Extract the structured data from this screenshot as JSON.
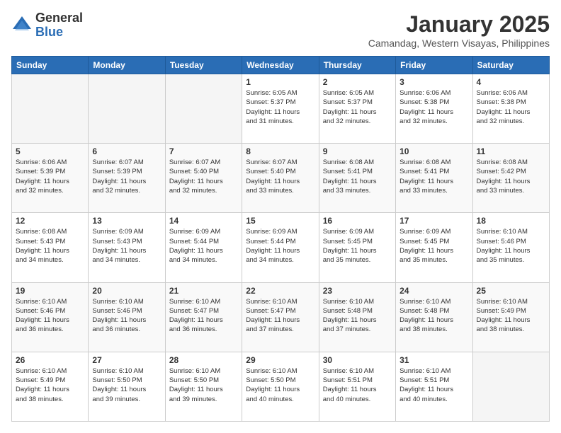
{
  "header": {
    "logo_general": "General",
    "logo_blue": "Blue",
    "month_title": "January 2025",
    "location": "Camandag, Western Visayas, Philippines"
  },
  "weekdays": [
    "Sunday",
    "Monday",
    "Tuesday",
    "Wednesday",
    "Thursday",
    "Friday",
    "Saturday"
  ],
  "weeks": [
    [
      {
        "day": "",
        "info": ""
      },
      {
        "day": "",
        "info": ""
      },
      {
        "day": "",
        "info": ""
      },
      {
        "day": "1",
        "info": "Sunrise: 6:05 AM\nSunset: 5:37 PM\nDaylight: 11 hours\nand 31 minutes."
      },
      {
        "day": "2",
        "info": "Sunrise: 6:05 AM\nSunset: 5:37 PM\nDaylight: 11 hours\nand 32 minutes."
      },
      {
        "day": "3",
        "info": "Sunrise: 6:06 AM\nSunset: 5:38 PM\nDaylight: 11 hours\nand 32 minutes."
      },
      {
        "day": "4",
        "info": "Sunrise: 6:06 AM\nSunset: 5:38 PM\nDaylight: 11 hours\nand 32 minutes."
      }
    ],
    [
      {
        "day": "5",
        "info": "Sunrise: 6:06 AM\nSunset: 5:39 PM\nDaylight: 11 hours\nand 32 minutes."
      },
      {
        "day": "6",
        "info": "Sunrise: 6:07 AM\nSunset: 5:39 PM\nDaylight: 11 hours\nand 32 minutes."
      },
      {
        "day": "7",
        "info": "Sunrise: 6:07 AM\nSunset: 5:40 PM\nDaylight: 11 hours\nand 32 minutes."
      },
      {
        "day": "8",
        "info": "Sunrise: 6:07 AM\nSunset: 5:40 PM\nDaylight: 11 hours\nand 33 minutes."
      },
      {
        "day": "9",
        "info": "Sunrise: 6:08 AM\nSunset: 5:41 PM\nDaylight: 11 hours\nand 33 minutes."
      },
      {
        "day": "10",
        "info": "Sunrise: 6:08 AM\nSunset: 5:41 PM\nDaylight: 11 hours\nand 33 minutes."
      },
      {
        "day": "11",
        "info": "Sunrise: 6:08 AM\nSunset: 5:42 PM\nDaylight: 11 hours\nand 33 minutes."
      }
    ],
    [
      {
        "day": "12",
        "info": "Sunrise: 6:08 AM\nSunset: 5:43 PM\nDaylight: 11 hours\nand 34 minutes."
      },
      {
        "day": "13",
        "info": "Sunrise: 6:09 AM\nSunset: 5:43 PM\nDaylight: 11 hours\nand 34 minutes."
      },
      {
        "day": "14",
        "info": "Sunrise: 6:09 AM\nSunset: 5:44 PM\nDaylight: 11 hours\nand 34 minutes."
      },
      {
        "day": "15",
        "info": "Sunrise: 6:09 AM\nSunset: 5:44 PM\nDaylight: 11 hours\nand 34 minutes."
      },
      {
        "day": "16",
        "info": "Sunrise: 6:09 AM\nSunset: 5:45 PM\nDaylight: 11 hours\nand 35 minutes."
      },
      {
        "day": "17",
        "info": "Sunrise: 6:09 AM\nSunset: 5:45 PM\nDaylight: 11 hours\nand 35 minutes."
      },
      {
        "day": "18",
        "info": "Sunrise: 6:10 AM\nSunset: 5:46 PM\nDaylight: 11 hours\nand 35 minutes."
      }
    ],
    [
      {
        "day": "19",
        "info": "Sunrise: 6:10 AM\nSunset: 5:46 PM\nDaylight: 11 hours\nand 36 minutes."
      },
      {
        "day": "20",
        "info": "Sunrise: 6:10 AM\nSunset: 5:46 PM\nDaylight: 11 hours\nand 36 minutes."
      },
      {
        "day": "21",
        "info": "Sunrise: 6:10 AM\nSunset: 5:47 PM\nDaylight: 11 hours\nand 36 minutes."
      },
      {
        "day": "22",
        "info": "Sunrise: 6:10 AM\nSunset: 5:47 PM\nDaylight: 11 hours\nand 37 minutes."
      },
      {
        "day": "23",
        "info": "Sunrise: 6:10 AM\nSunset: 5:48 PM\nDaylight: 11 hours\nand 37 minutes."
      },
      {
        "day": "24",
        "info": "Sunrise: 6:10 AM\nSunset: 5:48 PM\nDaylight: 11 hours\nand 38 minutes."
      },
      {
        "day": "25",
        "info": "Sunrise: 6:10 AM\nSunset: 5:49 PM\nDaylight: 11 hours\nand 38 minutes."
      }
    ],
    [
      {
        "day": "26",
        "info": "Sunrise: 6:10 AM\nSunset: 5:49 PM\nDaylight: 11 hours\nand 38 minutes."
      },
      {
        "day": "27",
        "info": "Sunrise: 6:10 AM\nSunset: 5:50 PM\nDaylight: 11 hours\nand 39 minutes."
      },
      {
        "day": "28",
        "info": "Sunrise: 6:10 AM\nSunset: 5:50 PM\nDaylight: 11 hours\nand 39 minutes."
      },
      {
        "day": "29",
        "info": "Sunrise: 6:10 AM\nSunset: 5:50 PM\nDaylight: 11 hours\nand 40 minutes."
      },
      {
        "day": "30",
        "info": "Sunrise: 6:10 AM\nSunset: 5:51 PM\nDaylight: 11 hours\nand 40 minutes."
      },
      {
        "day": "31",
        "info": "Sunrise: 6:10 AM\nSunset: 5:51 PM\nDaylight: 11 hours\nand 40 minutes."
      },
      {
        "day": "",
        "info": ""
      }
    ]
  ]
}
